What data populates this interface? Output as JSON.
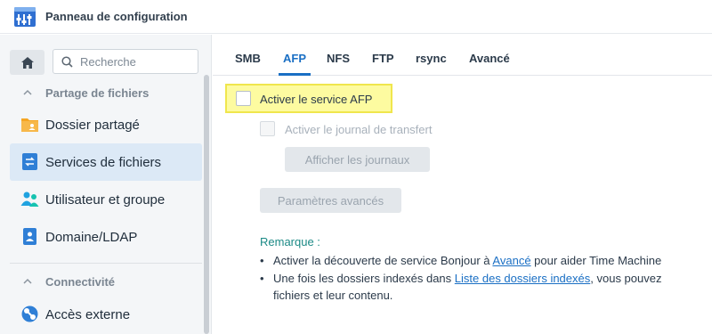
{
  "window": {
    "title": "Panneau de configuration"
  },
  "search": {
    "placeholder": "Recherche"
  },
  "sidebar": {
    "sections": [
      {
        "label": "Partage de fichiers"
      },
      {
        "label": "Connectivité"
      }
    ],
    "items": [
      {
        "label": "Dossier partagé",
        "icon": "folder-share-icon"
      },
      {
        "label": "Services de fichiers",
        "icon": "file-services-icon",
        "active": true
      },
      {
        "label": "Utilisateur et groupe",
        "icon": "users-icon"
      },
      {
        "label": "Domaine/LDAP",
        "icon": "domain-icon"
      },
      {
        "label": "Accès externe",
        "icon": "external-access-icon"
      }
    ]
  },
  "tabs": [
    {
      "label": "SMB"
    },
    {
      "label": "AFP",
      "active": true
    },
    {
      "label": "NFS"
    },
    {
      "label": "FTP"
    },
    {
      "label": "rsync"
    },
    {
      "label": "Avancé"
    }
  ],
  "afp": {
    "enable_service_label": "Activer le service AFP",
    "enable_log_label": "Activer le journal de transfert",
    "show_logs_button": "Afficher les journaux",
    "advanced_params_button": "Paramètres avancés"
  },
  "remark": {
    "title": "Remarque :",
    "bullet1_before": "Activer la découverte de service Bonjour à ",
    "bullet1_link": "Avancé",
    "bullet1_after": " pour aider Time Machine",
    "bullet2_before": "Une fois les dossiers indexés dans ",
    "bullet2_link": "Liste des dossiers indexés",
    "bullet2_after": ", vous pouvez",
    "bullet2_cont": "fichiers et leur contenu."
  },
  "colors": {
    "accent": "#1a6fc4",
    "highlight": "#fdfba0",
    "remark": "#1c8a86"
  }
}
